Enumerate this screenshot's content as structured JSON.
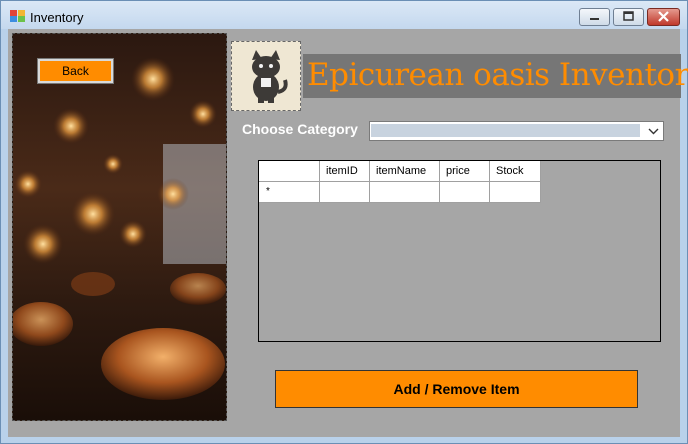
{
  "window": {
    "title": "Inventory",
    "controls": [
      "minimize",
      "maximize",
      "close"
    ]
  },
  "sidebar": {
    "back_label": "Back"
  },
  "header": {
    "title": "Epicurean oasis Inventory",
    "logo_icon": "cat-icon"
  },
  "category": {
    "label": "Choose Category",
    "selected": ""
  },
  "table": {
    "columns": [
      "itemID",
      "itemName",
      "price",
      "Stock"
    ],
    "new_row_marker": "*",
    "rows": []
  },
  "actions": {
    "add_remove_label": "Add / Remove Item"
  },
  "colors": {
    "accent": "#ff8c00",
    "form_bg": "#a6a6a6",
    "banner_bg": "#767676"
  }
}
